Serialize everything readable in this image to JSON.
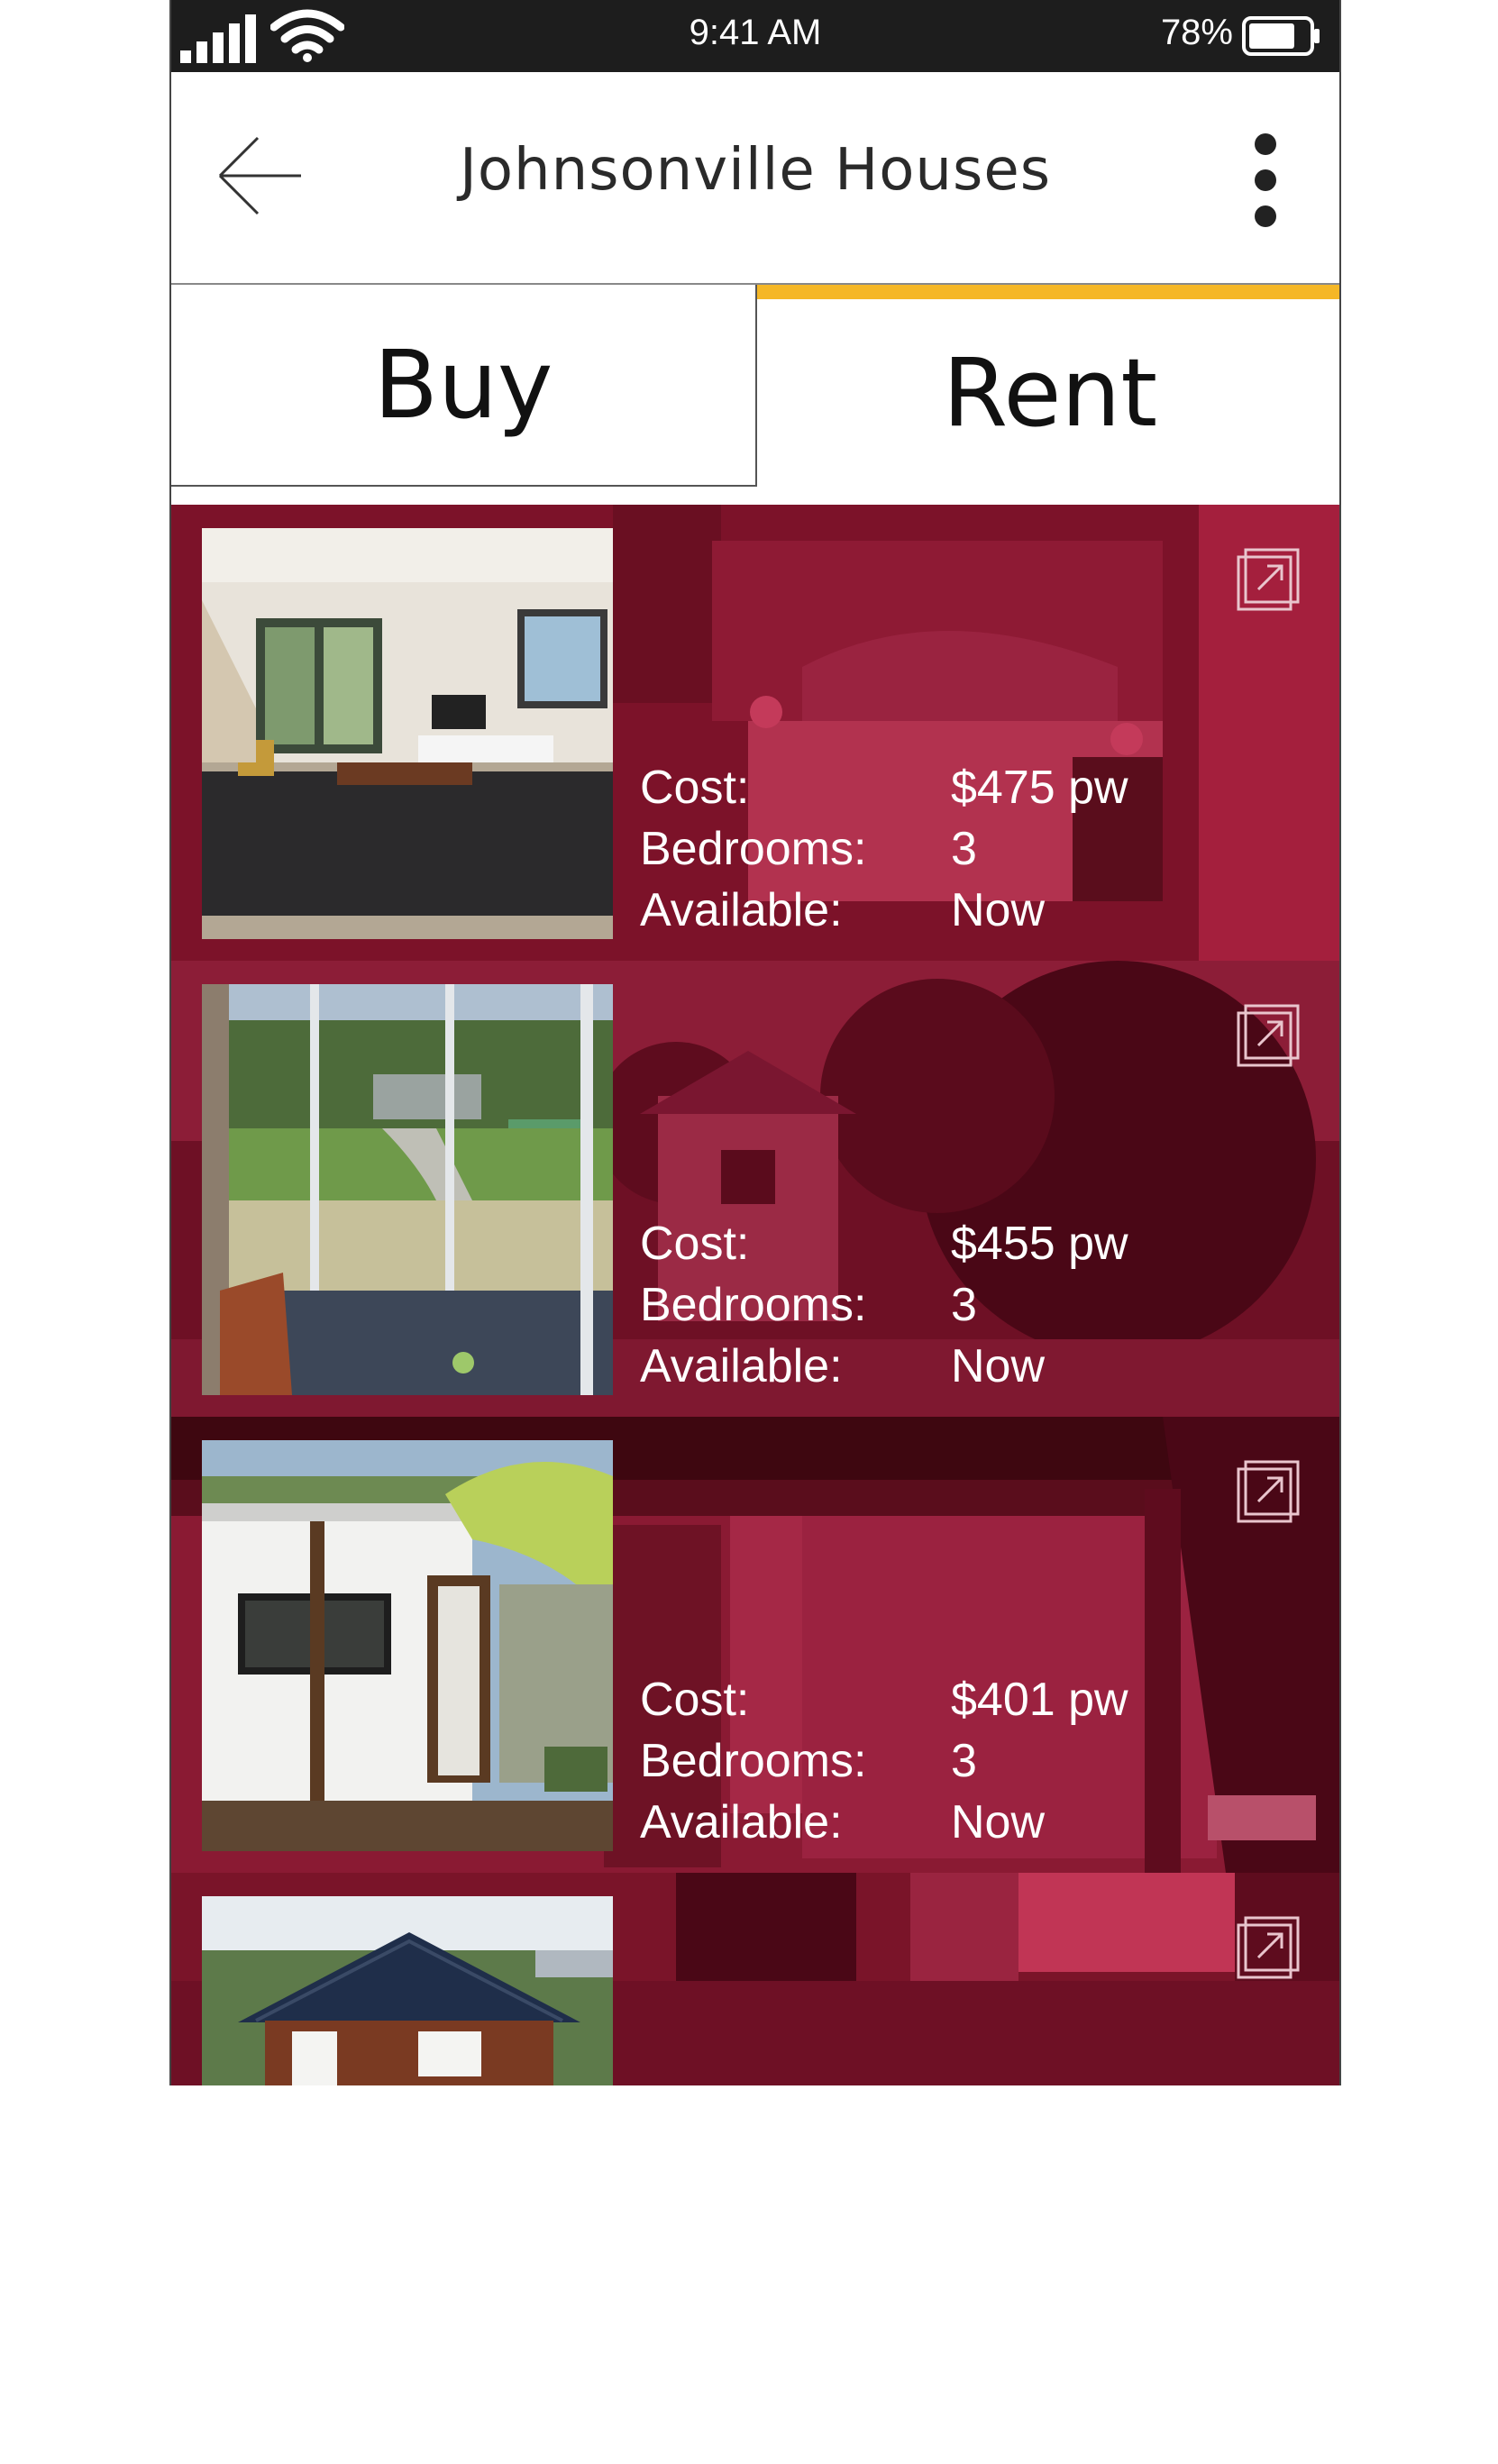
{
  "status_bar": {
    "time": "9:41 AM",
    "battery": "78%",
    "battery_level": 0.78,
    "icons": [
      "signal-icon",
      "wifi-icon",
      "battery-icon"
    ]
  },
  "header": {
    "title": "Johnsonville Houses",
    "back_icon": "arrow-left-icon",
    "menu_icon": "more-vertical-icon"
  },
  "tabs": [
    {
      "label": "Buy",
      "active": false
    },
    {
      "label": "Rent",
      "active": true
    }
  ],
  "colors": {
    "accent": "#f5b726",
    "card_overlay": "#8a1530",
    "status_bar": "#1d1d1d"
  },
  "listings": [
    {
      "cost_label": "Cost:",
      "cost": "$475 pw",
      "bedrooms_label": "Bedrooms:",
      "bedrooms": "3",
      "available_label": "Available:",
      "available": "Now"
    },
    {
      "cost_label": "Cost:",
      "cost": "$455 pw",
      "bedrooms_label": "Bedrooms:",
      "bedrooms": "3",
      "available_label": "Available:",
      "available": "Now"
    },
    {
      "cost_label": "Cost:",
      "cost": "$401 pw",
      "bedrooms_label": "Bedrooms:",
      "bedrooms": "3",
      "available_label": "Available:",
      "available": "Now"
    },
    {
      "cost_label": "",
      "cost": "",
      "bedrooms_label": "",
      "bedrooms": "",
      "available_label": "",
      "available": ""
    }
  ]
}
